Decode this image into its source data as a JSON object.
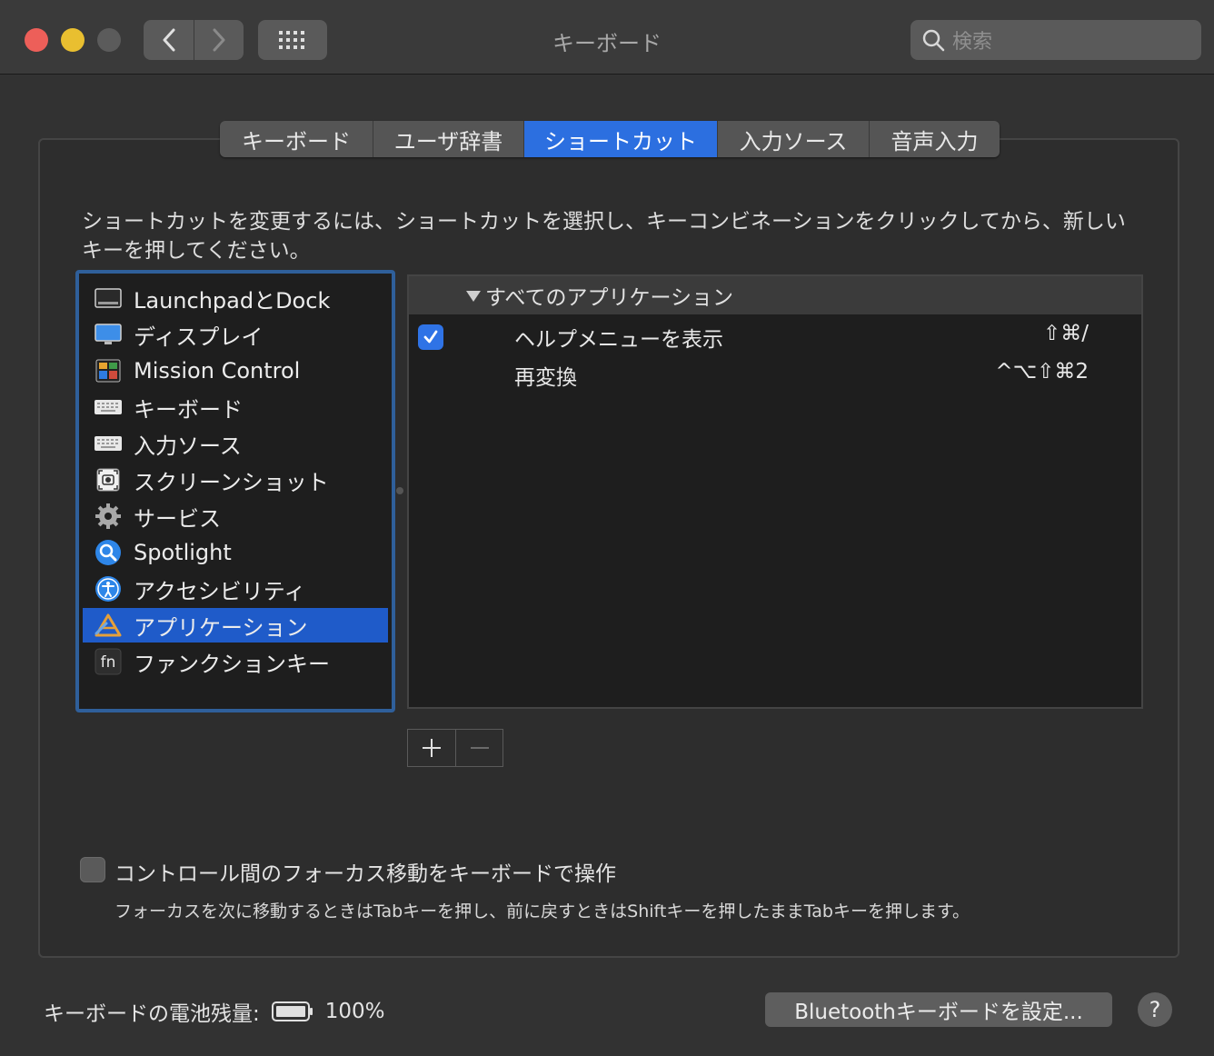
{
  "window": {
    "title": "キーボード"
  },
  "search": {
    "placeholder": "検索"
  },
  "tabs": [
    {
      "label": "キーボード"
    },
    {
      "label": "ユーザ辞書"
    },
    {
      "label": "ショートカット"
    },
    {
      "label": "入力ソース"
    },
    {
      "label": "音声入力"
    }
  ],
  "description": "ショートカットを変更するには、ショートカットを選択し、キーコンビネーションをクリックしてから、新しいキーを押してください。",
  "categories": [
    {
      "label": "LaunchpadとDock",
      "icon": "launchpad-dock-icon"
    },
    {
      "label": "ディスプレイ",
      "icon": "display-icon"
    },
    {
      "label": "Mission Control",
      "icon": "mission-control-icon"
    },
    {
      "label": "キーボード",
      "icon": "keyboard-icon"
    },
    {
      "label": "入力ソース",
      "icon": "input-source-icon"
    },
    {
      "label": "スクリーンショット",
      "icon": "screenshot-icon"
    },
    {
      "label": "サービス",
      "icon": "gear-icon"
    },
    {
      "label": "Spotlight",
      "icon": "spotlight-icon"
    },
    {
      "label": "アクセシビリティ",
      "icon": "accessibility-icon"
    },
    {
      "label": "アプリケーション",
      "icon": "app-store-icon"
    },
    {
      "label": "ファンクションキー",
      "icon": "fn-key-icon"
    }
  ],
  "selected_category": "アプリケーション",
  "shortcuts": {
    "group_label": "すべてのアプリケーション",
    "rows": [
      {
        "name": "ヘルプメニューを表示",
        "keys": "⇧⌘/",
        "checked": true
      },
      {
        "name": "再変換",
        "keys": "^⌥⇧⌘2",
        "checked": false
      }
    ]
  },
  "focus": {
    "label": "コントロール間のフォーカス移動をキーボードで操作",
    "hint": "フォーカスを次に移動するときはTabキーを押し、前に戻すときはShiftキーを押したままTabキーを押します。",
    "checked": false
  },
  "battery": {
    "label": "キーボードの電池残量:",
    "value": "100%"
  },
  "bluetooth_button": "Bluetoothキーボードを設定...",
  "help_button": "?",
  "colors": {
    "accent": "#2c6fe0",
    "selection": "#1f5bc9"
  }
}
